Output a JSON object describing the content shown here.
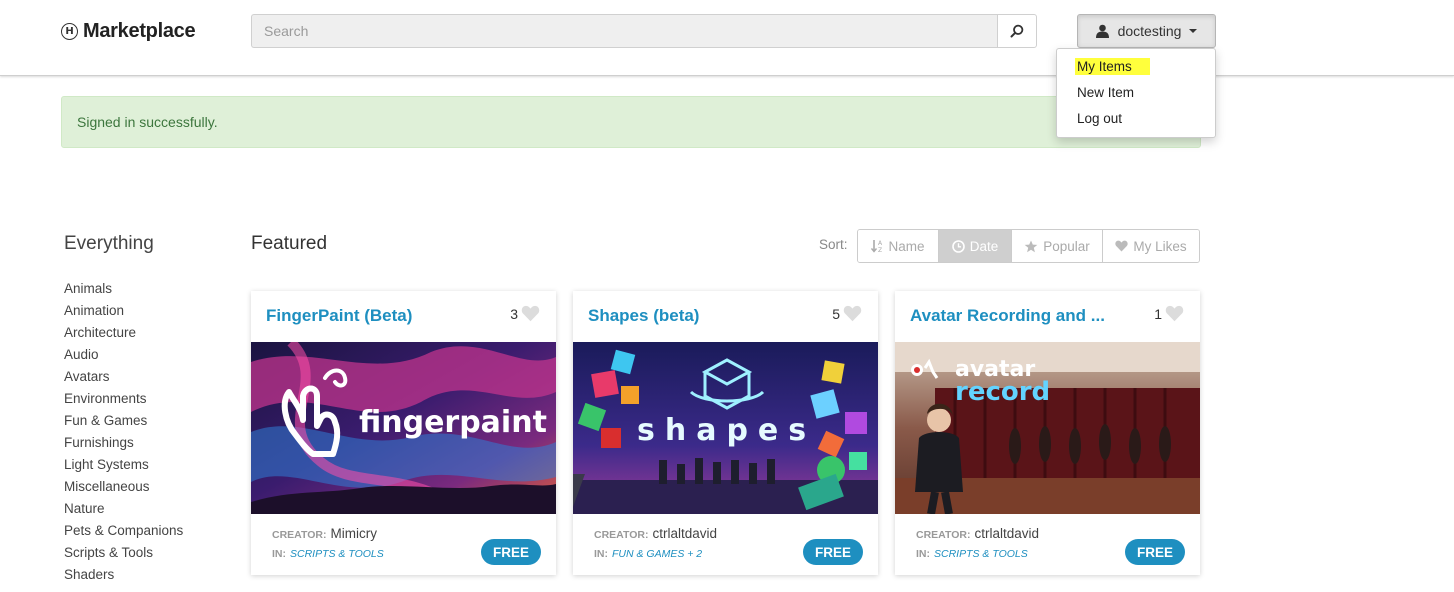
{
  "header": {
    "brand": "Marketplace",
    "search_placeholder": "Search",
    "user": "doctesting"
  },
  "dropdown": {
    "items": [
      "My Items",
      "New Item",
      "Log out"
    ]
  },
  "alert": "Signed in successfully.",
  "sidebar": {
    "title": "Everything",
    "items": [
      "Animals",
      "Animation",
      "Architecture",
      "Audio",
      "Avatars",
      "Environments",
      "Fun & Games",
      "Furnishings",
      "Light Systems",
      "Miscellaneous",
      "Nature",
      "Pets & Companions",
      "Scripts & Tools",
      "Shaders"
    ]
  },
  "main": {
    "title": "Featured",
    "sort_label": "Sort:",
    "sort_options": [
      "Name",
      "Date",
      "Popular",
      "My Likes"
    ],
    "sort_active": "Date"
  },
  "cards": [
    {
      "title": "FingerPaint (Beta)",
      "likes": "3",
      "image_text": "fingerpaint",
      "creator_label": "CREATOR:",
      "creator": "Mimicry",
      "in_label": "IN:",
      "category": "SCRIPTS & TOOLS",
      "price": "FREE"
    },
    {
      "title": "Shapes (beta)",
      "likes": "5",
      "image_text": "shapes",
      "creator_label": "CREATOR:",
      "creator": "ctrlaltdavid",
      "in_label": "IN:",
      "category": "FUN & GAMES + 2",
      "price": "FREE"
    },
    {
      "title": "Avatar Recording and ...",
      "likes": "1",
      "image_text_1": "avatar",
      "image_text_2": "record",
      "creator_label": "CREATOR:",
      "creator": "ctrlaltdavid",
      "in_label": "IN:",
      "category": "SCRIPTS & TOOLS",
      "price": "FREE"
    }
  ],
  "colors": {
    "accent": "#1e8fc0",
    "alert_bg": "#dff0d8",
    "alert_text": "#3c763d",
    "highlight": "#ffff3c"
  },
  "icons": [
    "brand-logo-icon",
    "search-icon",
    "user-icon",
    "caret-down-icon",
    "sort-name-icon",
    "clock-icon",
    "star-icon",
    "heart-icon"
  ]
}
